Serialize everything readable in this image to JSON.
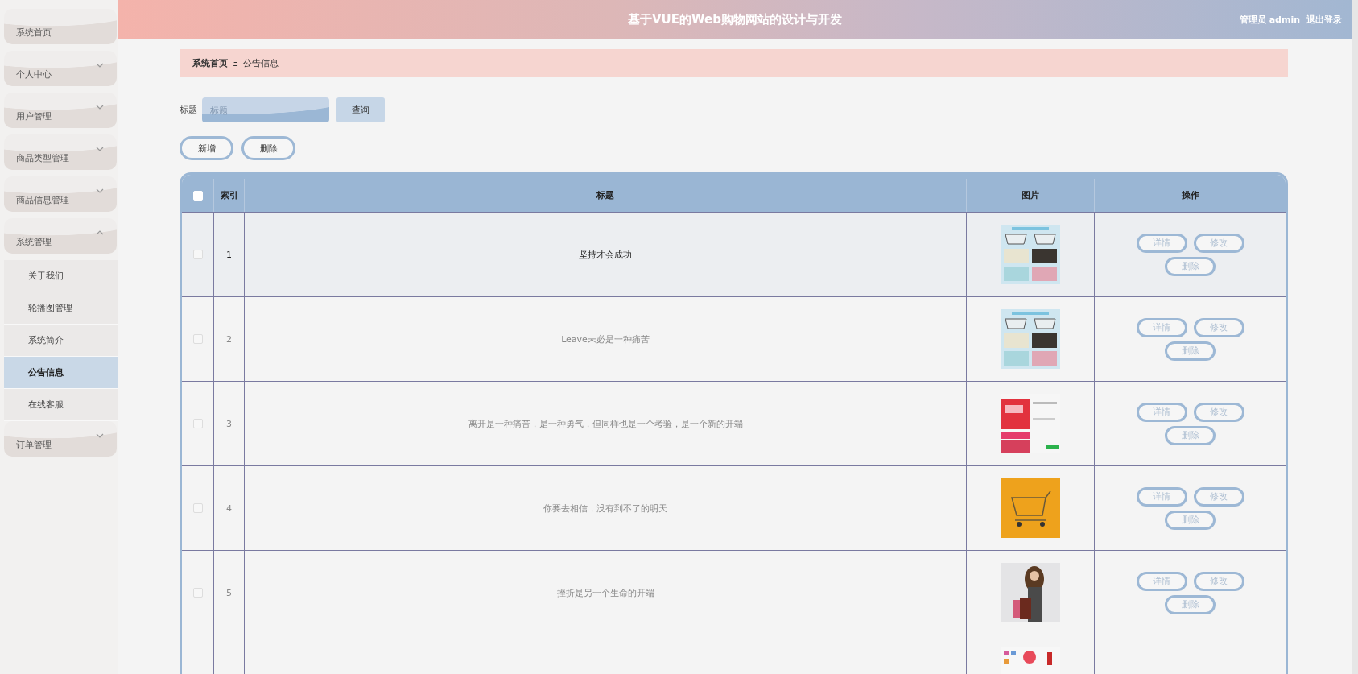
{
  "sidebar": {
    "items": [
      {
        "label": "系统首页"
      },
      {
        "label": "个人中心",
        "expanded": false
      },
      {
        "label": "用户管理",
        "expanded": false
      },
      {
        "label": "商品类型管理",
        "expanded": false
      },
      {
        "label": "商品信息管理",
        "expanded": false
      },
      {
        "label": "系统管理",
        "expanded": true,
        "children": [
          {
            "label": "关于我们",
            "selected": false
          },
          {
            "label": "轮播图管理",
            "selected": false
          },
          {
            "label": "系统简介",
            "selected": false
          },
          {
            "label": "公告信息",
            "selected": true
          },
          {
            "label": "在线客服",
            "selected": false
          }
        ]
      },
      {
        "label": "订单管理",
        "expanded": false
      }
    ]
  },
  "header": {
    "title": "基于VUE的Web购物网站的设计与开发",
    "user": "管理员 admin",
    "logout": "退出登录"
  },
  "breadcrumb": {
    "home": "系统首页",
    "separator": "Ξ",
    "current": "公告信息"
  },
  "search": {
    "label": "标题",
    "placeholder": "标题",
    "button": "查询"
  },
  "actions": [
    "新增",
    "删除"
  ],
  "table": {
    "columns": [
      "索引",
      "标题",
      "图片",
      "操作"
    ],
    "select_all": {
      "checked": false
    },
    "rows": [
      {
        "index": "1",
        "title": "坚持才会成功",
        "selected": true,
        "checked": false,
        "image": {
          "kind": "picture"
        },
        "buttons": [
          "详情",
          "修改",
          "删除"
        ]
      },
      {
        "index": "2",
        "title": "Leave未必是一种痛苦",
        "selected": false,
        "checked": false,
        "image": {
          "kind": "picture"
        },
        "buttons": [
          "详情",
          "修改",
          "删除"
        ]
      },
      {
        "index": "3",
        "title": "离开是一种痛苦，是一种勇气，但同样也是一个考验，是一个新的开端",
        "selected": false,
        "checked": false,
        "image": {
          "kind": "picture"
        },
        "buttons": [
          "详情",
          "修改",
          "删除"
        ]
      },
      {
        "index": "4",
        "title": "你要去相信，没有到不了的明天",
        "selected": false,
        "checked": false,
        "image": {
          "kind": "picture"
        },
        "buttons": [
          "详情",
          "修改",
          "删除"
        ]
      },
      {
        "index": "5",
        "title": "挫折是另一个生命的开端",
        "selected": false,
        "checked": false,
        "image": {
          "kind": "picture"
        },
        "buttons": [
          "详情",
          "修改",
          "删除"
        ]
      },
      {
        "image": {
          "kind": "picture"
        }
      }
    ]
  }
}
